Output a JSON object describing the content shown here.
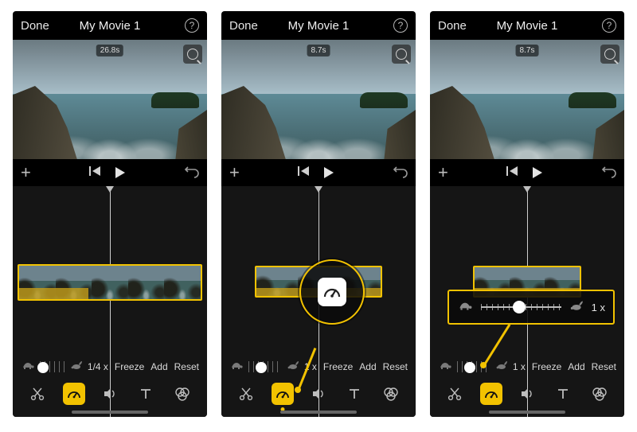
{
  "panels": [
    {
      "header": {
        "done": "Done",
        "title": "My Movie 1",
        "help": "?"
      },
      "preview": {
        "duration": "26.8s"
      },
      "ruler": {
        "speed_label": "1/4 x",
        "freeze": "Freeze",
        "add": "Add",
        "reset": "Reset",
        "knob_pct": 14
      },
      "selected_tool": "speedometer"
    },
    {
      "header": {
        "done": "Done",
        "title": "My Movie 1",
        "help": "?"
      },
      "preview": {
        "duration": "8.7s"
      },
      "ruler": {
        "speed_label": "1 x",
        "freeze": "Freeze",
        "add": "Add",
        "reset": "Reset",
        "knob_pct": 38
      },
      "selected_tool": "speedometer",
      "callout_tool": "speedometer"
    },
    {
      "header": {
        "done": "Done",
        "title": "My Movie 1",
        "help": "?"
      },
      "preview": {
        "duration": "8.7s"
      },
      "ruler": {
        "speed_label": "1 x",
        "freeze": "Freeze",
        "add": "Add",
        "reset": "Reset",
        "knob_pct": 38
      },
      "selected_tool": "speedometer",
      "callout_speed": "1 x"
    }
  ],
  "icons": {
    "turtle": "turtle-icon",
    "rabbit": "rabbit-icon",
    "scissors": "scissors-icon",
    "speedometer": "speedometer-icon",
    "volume": "volume-icon",
    "text": "text-icon",
    "filters": "filters-icon"
  }
}
